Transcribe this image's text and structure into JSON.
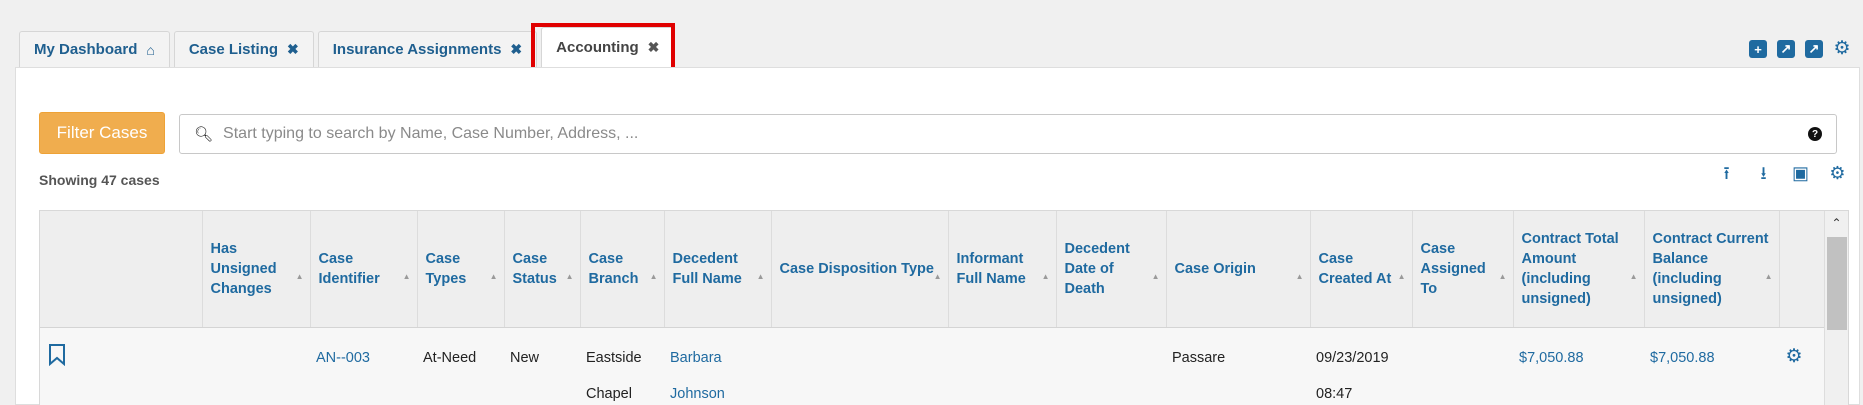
{
  "tabs": [
    {
      "label": "My Dashboard",
      "icon": "home-icon"
    },
    {
      "label": "Case Listing",
      "icon": "close-icon"
    },
    {
      "label": "Insurance Assignments",
      "icon": "close-icon"
    },
    {
      "label": "Accounting",
      "icon": "close-icon",
      "active": true
    }
  ],
  "filter_button": "Filter Cases",
  "search": {
    "placeholder": "Start typing to search by Name, Case Number, Address, ..."
  },
  "showing_text": "Showing 47 cases",
  "columns": [
    "",
    "Has Unsigned Changes",
    "Case Identifier",
    "Case Types",
    "Case Status",
    "Case Branch",
    "Decedent Full Name",
    "Case Disposition Type",
    "Informant Full Name",
    "Decedent Date of Death",
    "Case Origin",
    "Case Created At",
    "Case Assigned To",
    "Contract Total Amount (including unsigned)",
    "Contract Current Balance (including unsigned)",
    ""
  ],
  "rows": [
    {
      "has_unsigned": "",
      "case_identifier": "AN--003",
      "case_types": "At-Need",
      "case_status": "New",
      "case_branch": "Eastside Chapel",
      "decedent_name": "Barbara Johnson",
      "disposition_type": "",
      "informant_name": "",
      "date_of_death": "",
      "case_origin": "Passare",
      "created_at": "09/23/2019 08:47",
      "assigned_to": "",
      "contract_total": "$7,050.88",
      "contract_balance": "$7,050.88"
    }
  ],
  "colors": {
    "accent": "#1f6aa0",
    "filter_button": "#f0ad4e",
    "highlight": "#e00000"
  }
}
